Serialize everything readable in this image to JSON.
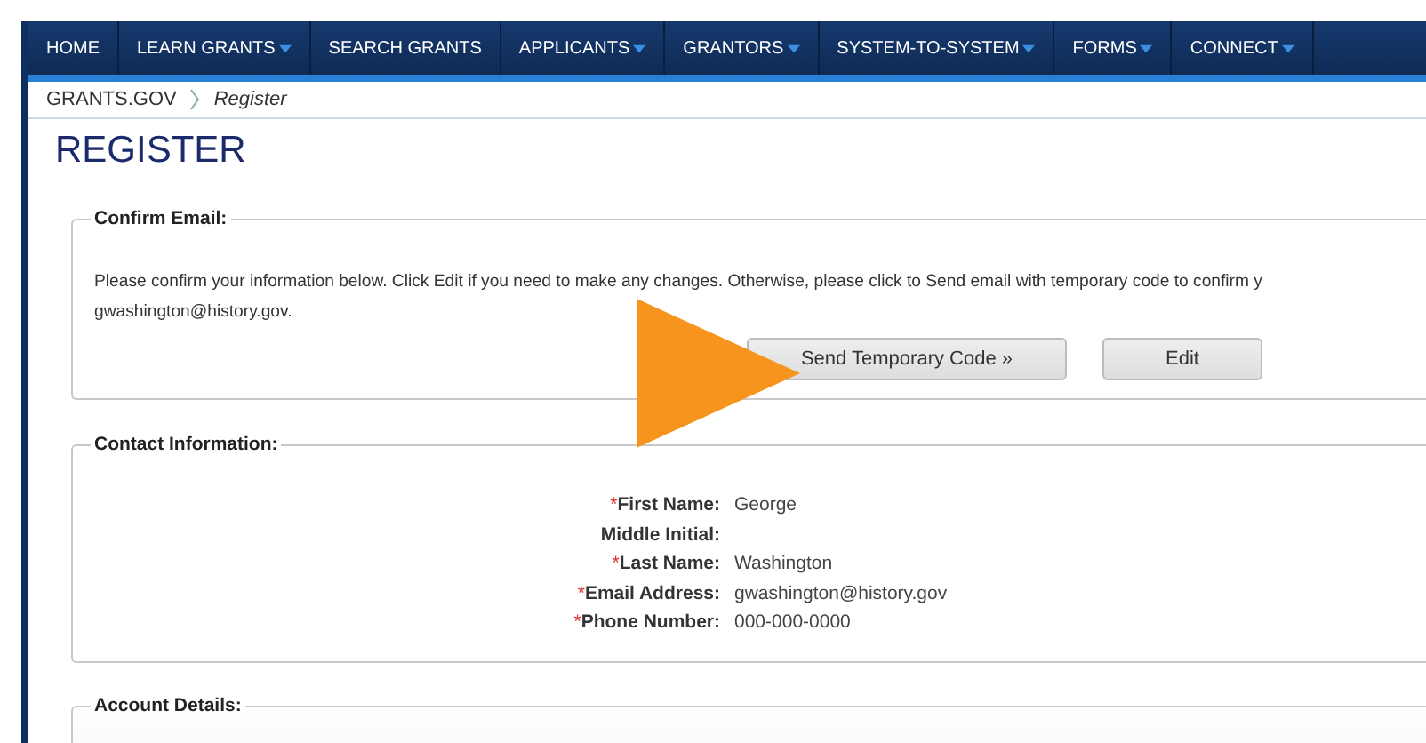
{
  "nav": [
    {
      "label": "HOME",
      "has_menu": false
    },
    {
      "label": "LEARN GRANTS",
      "has_menu": true
    },
    {
      "label": "SEARCH GRANTS",
      "has_menu": false
    },
    {
      "label": "APPLICANTS",
      "has_menu": true
    },
    {
      "label": "GRANTORS",
      "has_menu": true
    },
    {
      "label": "SYSTEM-TO-SYSTEM",
      "has_menu": true
    },
    {
      "label": "FORMS",
      "has_menu": true
    },
    {
      "label": "CONNECT",
      "has_menu": true
    }
  ],
  "breadcrumb": [
    {
      "label": "GRANTS.GOV",
      "current": false
    },
    {
      "label": "Register",
      "current": true
    }
  ],
  "page_title": "REGISTER",
  "confirm_email": {
    "legend": "Confirm Email:",
    "message": "Please confirm your information below. Click Edit if you need to make any changes. Otherwise, please click to Send email with temporary code to confirm y",
    "email": "gwashington@history.gov.",
    "buttons": [
      "Send Temporary Code »",
      "Edit"
    ]
  },
  "contact": {
    "legend": "Contact Information:",
    "fields": [
      {
        "mark": "*",
        "label": "First Name:",
        "value": "George"
      },
      {
        "label": "Middle Initial:"
      },
      {
        "mark": "*",
        "label": "Last Name:",
        "value": "Washington"
      },
      {
        "mark": "*",
        "label": "Email Address:",
        "value": "gwashington@history.gov"
      },
      {
        "mark": "*",
        "label": "Phone Number:",
        "value": "000-000-0000"
      }
    ]
  },
  "account": {
    "legend": "Account Details:"
  }
}
